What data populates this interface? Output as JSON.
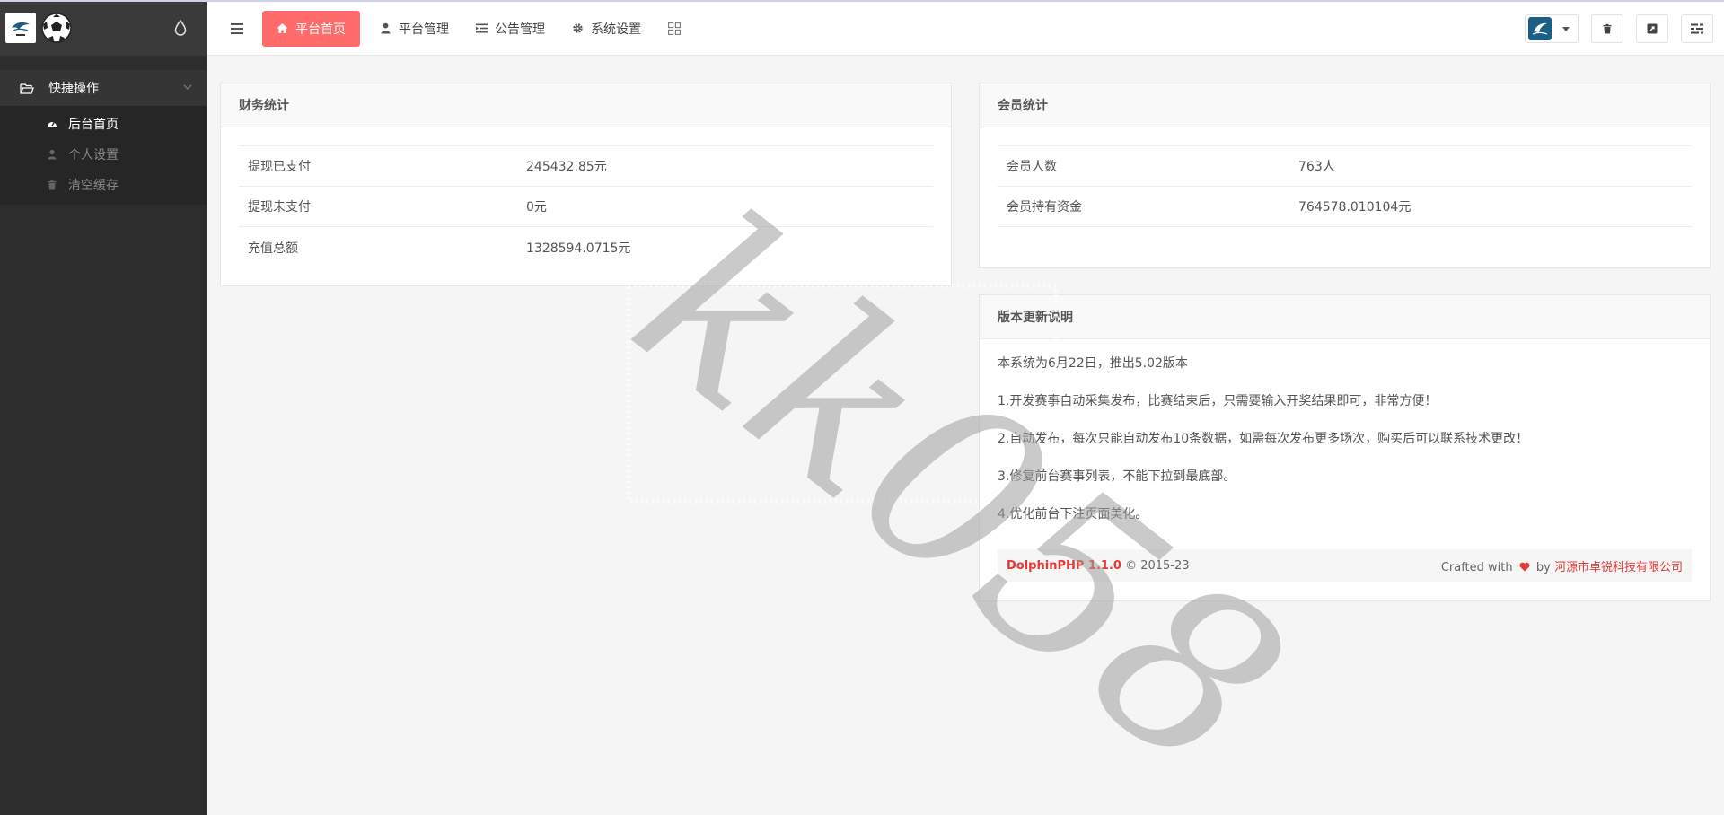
{
  "sidebar": {
    "group_label": "快捷操作",
    "items": [
      {
        "label": "后台首页"
      },
      {
        "label": "个人设置"
      },
      {
        "label": "清空缓存"
      }
    ]
  },
  "header": {
    "nav": [
      {
        "label": "平台首页"
      },
      {
        "label": "平台管理"
      },
      {
        "label": "公告管理"
      },
      {
        "label": "系统设置"
      }
    ]
  },
  "finance": {
    "title": "财务统计",
    "rows": [
      {
        "label": "提现已支付",
        "value": "245432.85元"
      },
      {
        "label": "提现未支付",
        "value": "0元"
      },
      {
        "label": "充值总额",
        "value": "1328594.0715元"
      }
    ]
  },
  "members": {
    "title": "会员统计",
    "rows": [
      {
        "label": "会员人数",
        "value": "763人"
      },
      {
        "label": "会员持有资金",
        "value": "764578.010104元"
      }
    ]
  },
  "version": {
    "title": "版本更新说明",
    "lines": [
      "本系统为6月22日，推出5.02版本",
      "1.开发赛事自动采集发布，比赛结束后，只需要输入开奖结果即可，非常方便！",
      "2.自动发布，每次只能自动发布10条数据，如需每次发布更多场次，购买后可以联系技术更改！",
      "3.修复前台赛事列表，不能下拉到最底部。",
      "4.优化前台下注页面美化。"
    ],
    "footer": {
      "product": "DolphinPHP 1.1.0",
      "copyright": "© 2015-23",
      "crafted": "Crafted with",
      "by": "by",
      "company": "河源市卓锐科技有限公司"
    }
  },
  "watermark": "kk058",
  "colors": {
    "sidebar_bg": "#2d2d2d",
    "accent": "#ff6b6b",
    "link_red": "#e53935"
  }
}
